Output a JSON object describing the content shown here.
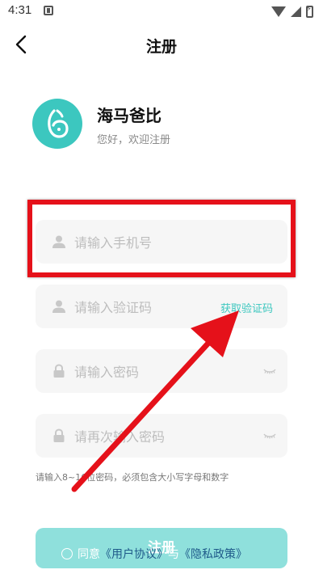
{
  "status_bar": {
    "time": "4:31"
  },
  "header": {
    "title": "注册"
  },
  "brand": {
    "name": "海马爸比",
    "subtitle": "您好，欢迎注册"
  },
  "form": {
    "phone_placeholder": "请输入手机号",
    "code_placeholder": "请输入验证码",
    "get_code_label": "获取验证码",
    "password_placeholder": "请输入密码",
    "confirm_password_placeholder": "请再次输入密码",
    "password_hint": "请输入8~16位密码，必须包含大小写字母和数字"
  },
  "register_button": {
    "label": "注册"
  },
  "agreement": {
    "prefix": "同意",
    "user_agreement": "《用户协议》",
    "conjunction": "与",
    "privacy_policy": "《隐私政策》"
  },
  "colors": {
    "accent": "#3cc7bf",
    "button": "#8fe0dc",
    "annotation": "#e5111a"
  }
}
